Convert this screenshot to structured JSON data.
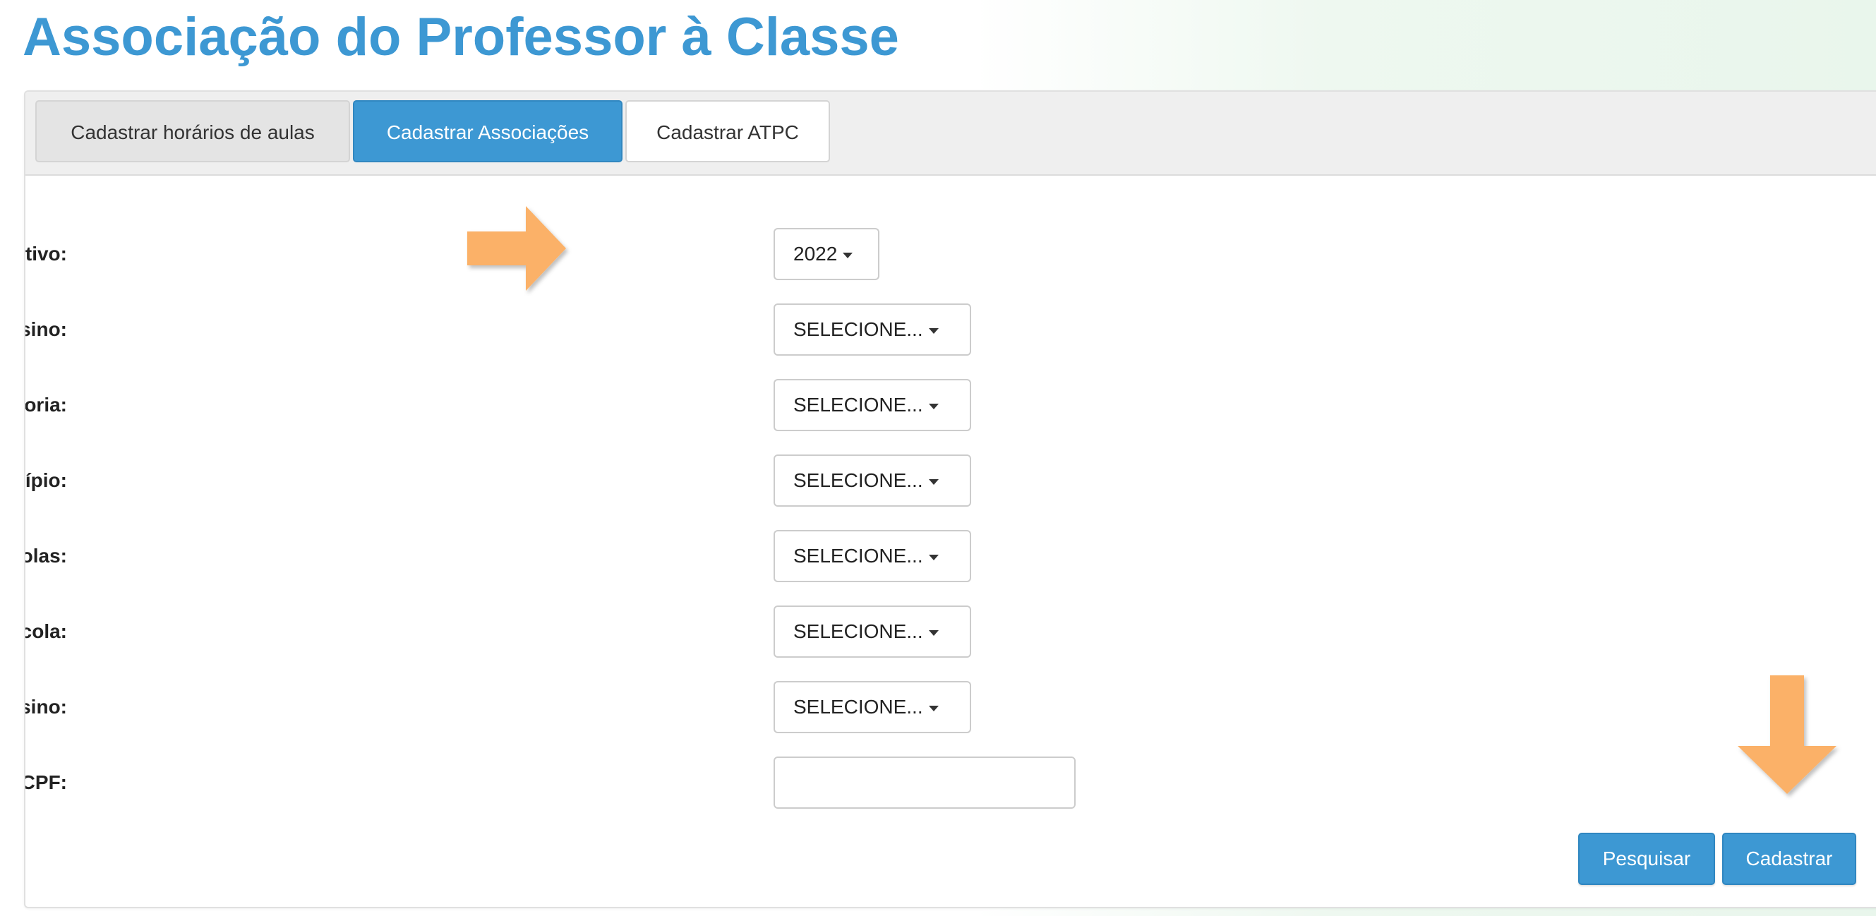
{
  "page": {
    "title": "Associação do Professor à Classe"
  },
  "tabs": [
    {
      "label": "Cadastrar horários de aulas",
      "active": false
    },
    {
      "label": "Cadastrar Associações",
      "active": true
    },
    {
      "label": "Cadastrar ATPC",
      "active": false
    }
  ],
  "form": {
    "ano_letivo": {
      "label": "Ano Letivo:",
      "value": "2022"
    },
    "rede_ensino": {
      "label": "Rede de Ensino:",
      "value": "SELECIONE..."
    },
    "diretoria": {
      "label": "Diretoria:",
      "value": "SELECIONE..."
    },
    "municipio": {
      "label": "Município:",
      "value": "SELECIONE..."
    },
    "situacao_escolas": {
      "label": "Situação das Escolas:",
      "value": "SELECIONE..."
    },
    "escola": {
      "label": "Escola:",
      "value": "SELECIONE..."
    },
    "tipo_ensino": {
      "label": "Tipo de Ensino:",
      "value": "SELECIONE..."
    },
    "cpf": {
      "label": "CPF:",
      "value": "",
      "placeholder": ""
    }
  },
  "actions": {
    "search_label": "Pesquisar",
    "register_label": "Cadastrar"
  },
  "colors": {
    "accent": "#3d98d3",
    "title": "#3d98d3",
    "annotation_arrow": "#fbb168"
  },
  "icons": {
    "dropdown": "caret-down-icon",
    "annotations": [
      "arrow-right-icon",
      "arrow-down-icon"
    ]
  }
}
